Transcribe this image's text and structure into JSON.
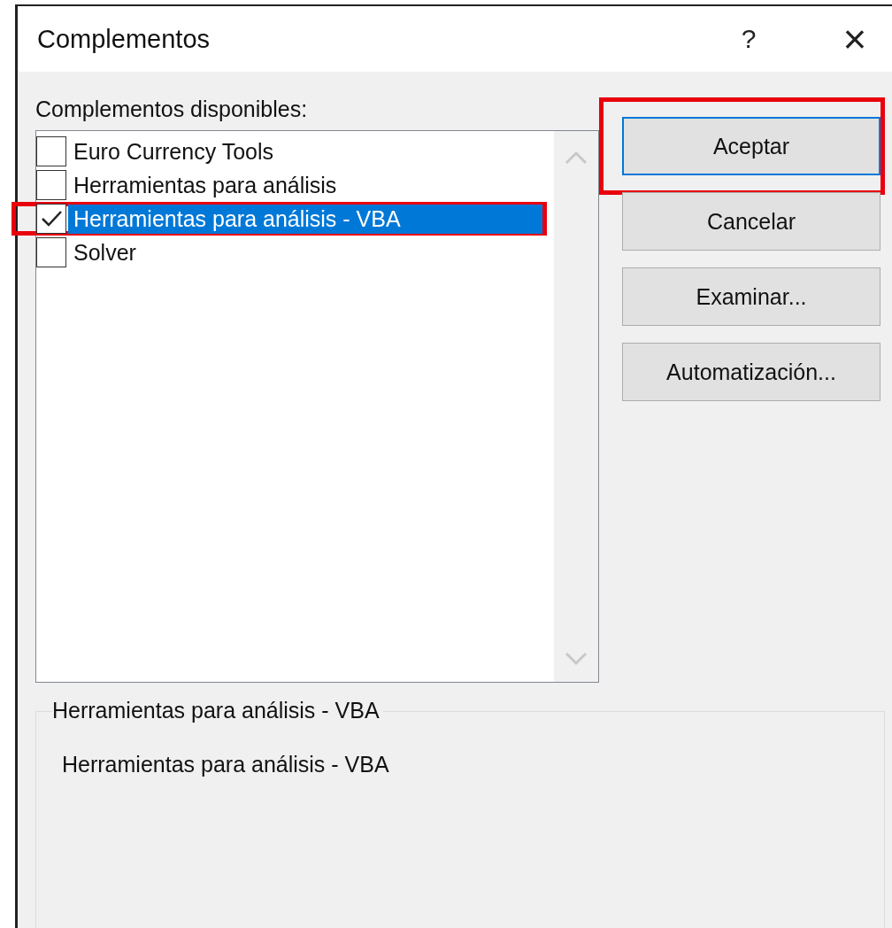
{
  "window": {
    "title": "Complementos",
    "help": "?",
    "close": "×"
  },
  "list_label": "Complementos disponibles:",
  "addins": [
    {
      "name": "Euro Currency Tools",
      "checked": false,
      "selected": false,
      "highlighted": false
    },
    {
      "name": "Herramientas para análisis",
      "checked": false,
      "selected": false,
      "highlighted": false
    },
    {
      "name": "Herramientas para análisis - VBA",
      "checked": true,
      "selected": true,
      "highlighted": true
    },
    {
      "name": "Solver",
      "checked": false,
      "selected": false,
      "highlighted": false
    }
  ],
  "buttons": [
    {
      "label": "Aceptar",
      "default": true,
      "highlighted": true
    },
    {
      "label": "Cancelar",
      "default": false,
      "highlighted": false
    },
    {
      "label": "Examinar...",
      "default": false,
      "highlighted": false
    },
    {
      "label": "Automatización...",
      "default": false,
      "highlighted": false
    }
  ],
  "description": {
    "title": "Herramientas para análisis - VBA",
    "text": "Herramientas para análisis - VBA"
  }
}
